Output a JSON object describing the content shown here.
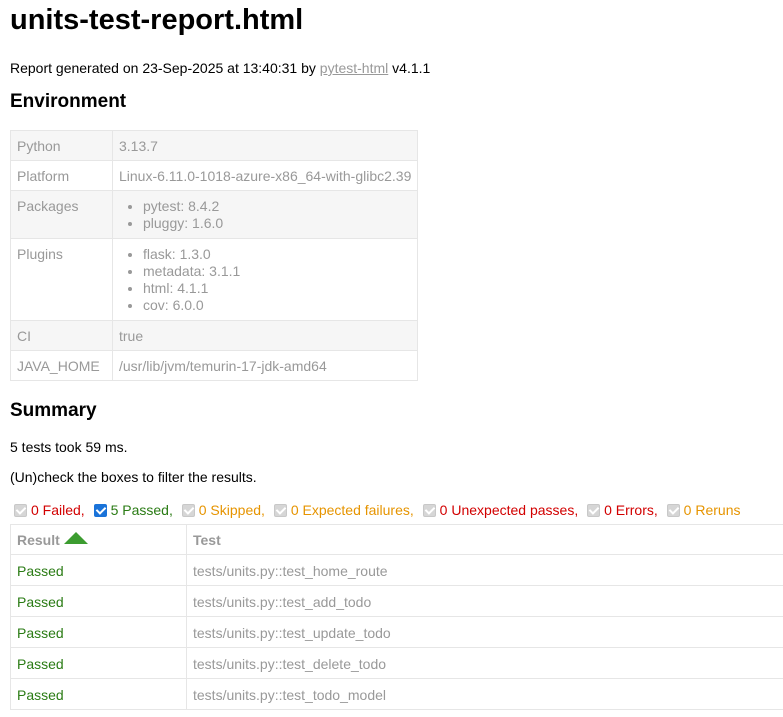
{
  "title": "units-test-report.html",
  "generated": {
    "prefix": "Report generated on 23-Sep-2025 at 13:40:31 by ",
    "link_text": "pytest-html",
    "suffix": " v4.1.1"
  },
  "environment": {
    "heading": "Environment",
    "python": {
      "key": "Python",
      "value": "3.13.7"
    },
    "platform": {
      "key": "Platform",
      "value": "Linux-6.11.0-1018-azure-x86_64-with-glibc2.39"
    },
    "packages": {
      "key": "Packages",
      "items": [
        "pytest: 8.4.2",
        "pluggy: 1.6.0"
      ]
    },
    "plugins": {
      "key": "Plugins",
      "items": [
        "flask: 1.3.0",
        "metadata: 3.1.1",
        "html: 4.1.1",
        "cov: 6.0.0"
      ]
    },
    "ci": {
      "key": "CI",
      "value": "true"
    },
    "java_home": {
      "key": "JAVA_HOME",
      "value": "/usr/lib/jvm/temurin-17-jdk-amd64"
    }
  },
  "summary": {
    "heading": "Summary",
    "took": "5 tests took 59 ms.",
    "filter_note": "(Un)check the boxes to filter the results."
  },
  "filters": {
    "failed": "0 Failed,",
    "passed": "5 Passed,",
    "skipped": "0 Skipped,",
    "xfailed": "0 Expected failures,",
    "xpassed": "0 Unexpected passes,",
    "errors": "0 Errors,",
    "reruns": "0 Reruns"
  },
  "results": {
    "col_result": "Result",
    "col_test": "Test",
    "rows": [
      {
        "result": "Passed",
        "test": "tests/units.py::test_home_route"
      },
      {
        "result": "Passed",
        "test": "tests/units.py::test_add_todo"
      },
      {
        "result": "Passed",
        "test": "tests/units.py::test_update_todo"
      },
      {
        "result": "Passed",
        "test": "tests/units.py::test_delete_todo"
      },
      {
        "result": "Passed",
        "test": "tests/units.py::test_todo_model"
      }
    ]
  },
  "colors": {
    "passed": "#2a7b14",
    "failed": "#d20000",
    "skipped": "#e69400",
    "sort_arrow": "#3c9c30"
  },
  "icons": {
    "sort": "sort-ascending-icon"
  }
}
